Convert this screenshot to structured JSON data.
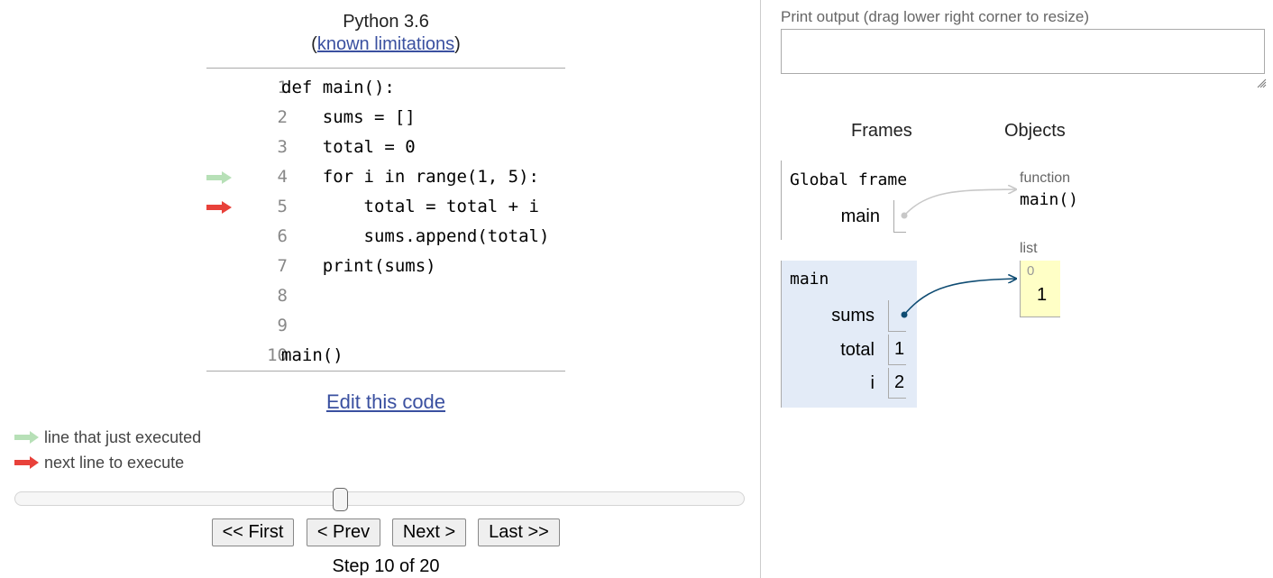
{
  "header": {
    "language": "Python 3.6",
    "limits_open": "(",
    "limits_link": "known limitations",
    "limits_close": ")"
  },
  "code": {
    "lines": [
      {
        "num": "1",
        "text": "def main():"
      },
      {
        "num": "2",
        "text": "    sums = []"
      },
      {
        "num": "3",
        "text": "    total = 0"
      },
      {
        "num": "4",
        "text": "    for i in range(1, 5):"
      },
      {
        "num": "5",
        "text": "        total = total + i"
      },
      {
        "num": "6",
        "text": "        sums.append(total)"
      },
      {
        "num": "7",
        "text": "    print(sums)"
      },
      {
        "num": "8",
        "text": ""
      },
      {
        "num": "9",
        "text": ""
      },
      {
        "num": "10",
        "text": "main()"
      }
    ],
    "just_executed_line": 4,
    "next_line": 5
  },
  "edit_link": "Edit this code",
  "legend": {
    "just_executed": "line that just executed",
    "next_to_execute": "next line to execute",
    "just_executed_color": "#b7e0b7",
    "next_color": "#e8413a"
  },
  "navigation": {
    "first": "<< First",
    "prev": "< Prev",
    "next": "Next >",
    "last": "Last >>",
    "step_label": "Step 10 of 20",
    "current_step": 10,
    "total_steps": 20
  },
  "output": {
    "label": "Print output (drag lower right corner to resize)",
    "content": ""
  },
  "viz": {
    "frames_header": "Frames",
    "objects_header": "Objects",
    "global_frame": {
      "title": "Global frame",
      "vars": [
        {
          "name": "main"
        }
      ]
    },
    "main_frame": {
      "title": "main",
      "vars": [
        {
          "name": "sums",
          "value": ""
        },
        {
          "name": "total",
          "value": "1"
        },
        {
          "name": "i",
          "value": "2"
        }
      ]
    },
    "function_obj": {
      "type": "function",
      "name": "main()"
    },
    "list_obj": {
      "type": "list",
      "index": "0",
      "value": "1"
    }
  }
}
